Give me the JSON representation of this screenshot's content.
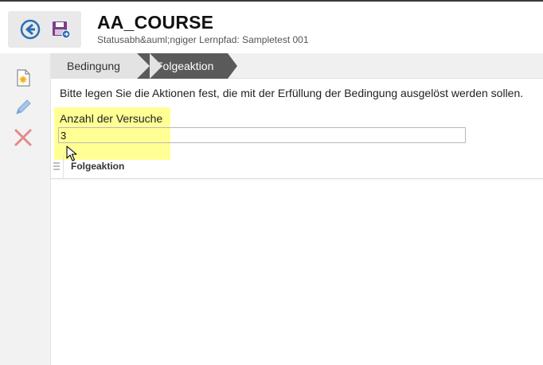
{
  "header": {
    "title": "AA_COURSE",
    "subtitle": "Statusabh&auml;ngiger Lernpfad: Sampletest 001",
    "back_icon": "arrow-left-circle-icon",
    "save_icon": "save-floppy-icon"
  },
  "sidebar": {
    "items": [
      {
        "icon": "new-document-icon"
      },
      {
        "icon": "pencil-edit-icon"
      },
      {
        "icon": "delete-x-icon"
      }
    ]
  },
  "tabs": [
    {
      "label": "Bedingung",
      "active": false
    },
    {
      "label": "Folgeaktion",
      "active": true
    }
  ],
  "main": {
    "instruction": "Bitte legen Sie die Aktionen fest, die mit der Erfüllung der Bedingung ausgelöst werden sollen.",
    "attempts_label": "Anzahl der Versuche",
    "attempts_value": "3",
    "table_column": "Folgeaktion"
  },
  "colors": {
    "accent": "#2a6fb6",
    "tab_active": "#5a5a5a",
    "highlight": "#ffff8a",
    "delete": "#e38a8a"
  }
}
